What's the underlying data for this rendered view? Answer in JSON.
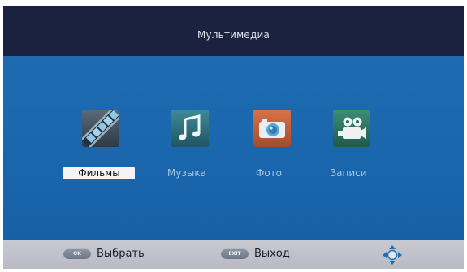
{
  "header": {
    "title": "Мультимедиа"
  },
  "menu": {
    "items": [
      {
        "label": "Фильмы",
        "icon": "film-icon",
        "selected": true
      },
      {
        "label": "Музыка",
        "icon": "music-note-icon",
        "selected": false
      },
      {
        "label": "Фото",
        "icon": "camera-icon",
        "selected": false
      },
      {
        "label": "Записи",
        "icon": "video-camera-icon",
        "selected": false
      }
    ]
  },
  "footer": {
    "ok_key": "OK",
    "ok_label": "Выбрать",
    "exit_key": "EXIT",
    "exit_label": "Выход",
    "nav_icon": "directional-pad-icon"
  },
  "colors": {
    "header_bg": "#1b2240",
    "main_bg": "#1a66ac",
    "footer_bg": "#c0c1ca",
    "selected_label_bg": "#f4f4f6"
  }
}
